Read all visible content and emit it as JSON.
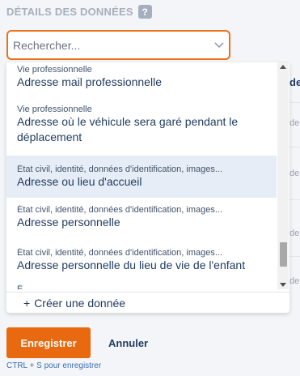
{
  "section": {
    "title": "DÉTAILS DES DONNÉES",
    "help": "?"
  },
  "search": {
    "placeholder": "Rechercher..."
  },
  "background": {
    "header": "de",
    "cell": "de"
  },
  "options": [
    {
      "category": "Vie professionnelle",
      "label": "Adresse mail professionnelle",
      "label2": ""
    },
    {
      "category": "Vie professionnelle",
      "label": "Adresse où le véhicule sera garé pendant le",
      "label2": "déplacement"
    },
    {
      "category": "État civil, identité, données d'identification, images...",
      "label": "Adresse ou lieu d'accueil",
      "label2": ""
    },
    {
      "category": "État civil, identité, données d'identification, images...",
      "label": "Adresse personnelle",
      "label2": ""
    },
    {
      "category": "État civil, identité, données d'identification, images...",
      "label": "Adresse personnelle du lieu de vie de l'enfant",
      "label2": ""
    },
    {
      "category": "É",
      "label": "",
      "label2": ""
    }
  ],
  "create": {
    "plus": "+",
    "label": "Créer une donnée"
  },
  "actions": {
    "save": "Enregistrer",
    "cancel": "Annuler",
    "shortcut": "CTRL + S pour enregistrer"
  }
}
